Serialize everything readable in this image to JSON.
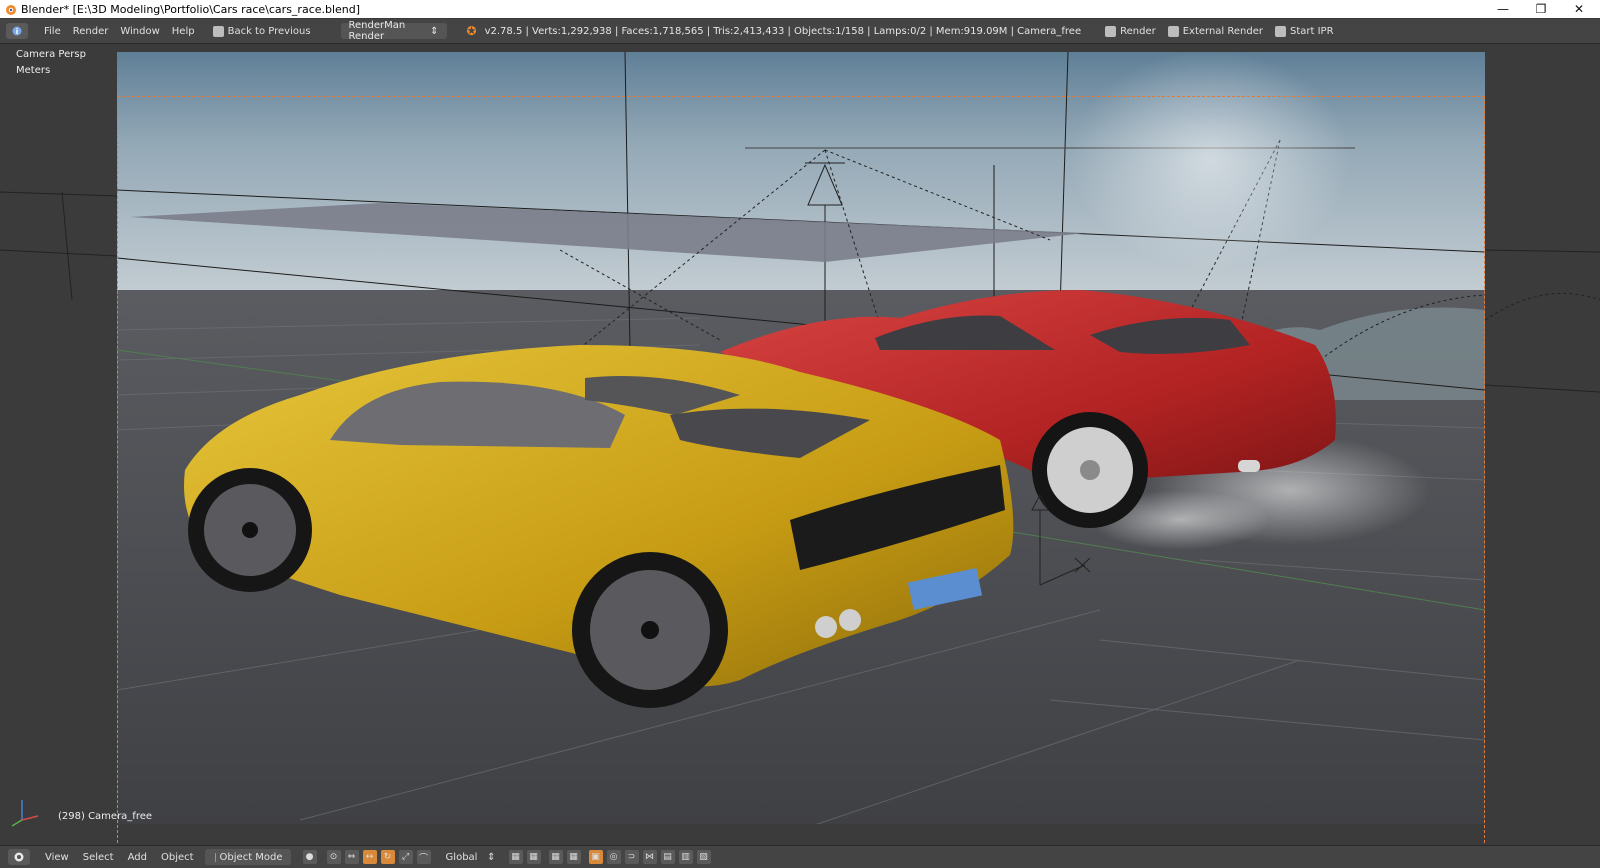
{
  "window": {
    "title": "Blender* [E:\\3D Modeling\\Portfolio\\Cars race\\cars_race.blend]",
    "controls": {
      "minimize": "—",
      "restore": "❐",
      "close": "✕"
    }
  },
  "info_header": {
    "menus": [
      "File",
      "Render",
      "Window",
      "Help"
    ],
    "back_to_previous": "Back to Previous",
    "render_engine": "RenderMan Render",
    "stats": "v2.78.5 | Verts:1,292,938 | Faces:1,718,565 | Tris:2,413,433 | Objects:1/158 | Lamps:0/2 | Mem:919.09M | Camera_free",
    "render_buttons": [
      "Render",
      "External Render",
      "Start IPR"
    ]
  },
  "viewport": {
    "view_name": "Camera Persp",
    "units": "Meters",
    "object_info": "(298) Camera_free"
  },
  "bottom_header": {
    "menus": [
      "View",
      "Select",
      "Add",
      "Object"
    ],
    "mode": "Object Mode",
    "orientation": "Global"
  },
  "colors": {
    "yellow_car": "#c9a21a",
    "red_car": "#b52222",
    "accent_orange": "#e07b39"
  }
}
